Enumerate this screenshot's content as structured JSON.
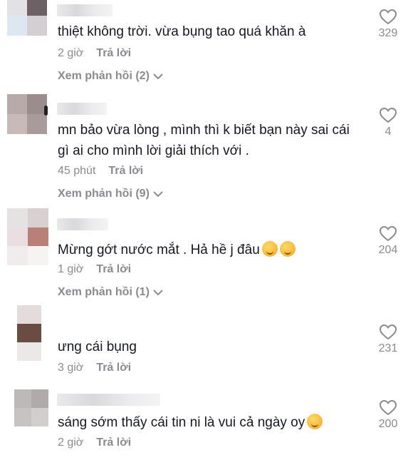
{
  "comments": [
    {
      "text": "thiệt không trời. vừa bụng tao quá khăn à",
      "time": "2 giờ",
      "reply_label": "Trả lời",
      "view_replies": "Xem phản hồi (2)",
      "likes": "329"
    },
    {
      "text": "mn bảo vừa lòng , mình thì k biết bạn này sai cái gì ai cho mình lời giải thích với .",
      "time": "45 phút",
      "reply_label": "Trả lời",
      "view_replies": "Xem phản hồi (9)",
      "likes": "4"
    },
    {
      "text": "Mừng gớt nước mắt . Hả hề j đâu",
      "time": "1 giờ",
      "reply_label": "Trả lời",
      "view_replies": "Xem phản hồi (1)",
      "likes": "204"
    },
    {
      "text": "ưng cái bụng",
      "time": "3 giờ",
      "reply_label": "Trả lời",
      "likes": "231"
    },
    {
      "text": "sáng sớm thấy cái tin ni là vui cả ngày oy",
      "time": "2 giờ",
      "reply_label": "Trả lời",
      "likes": "200"
    }
  ],
  "icons": {
    "like": "heart-outline-icon",
    "expand": "chevron-down-icon",
    "emoji_party": "partying-face-emoji",
    "emoji_laugh": "tears-of-joy-emoji"
  },
  "colors": {
    "text": "#161823",
    "muted": "#8a8b91",
    "background": "#ffffff"
  }
}
